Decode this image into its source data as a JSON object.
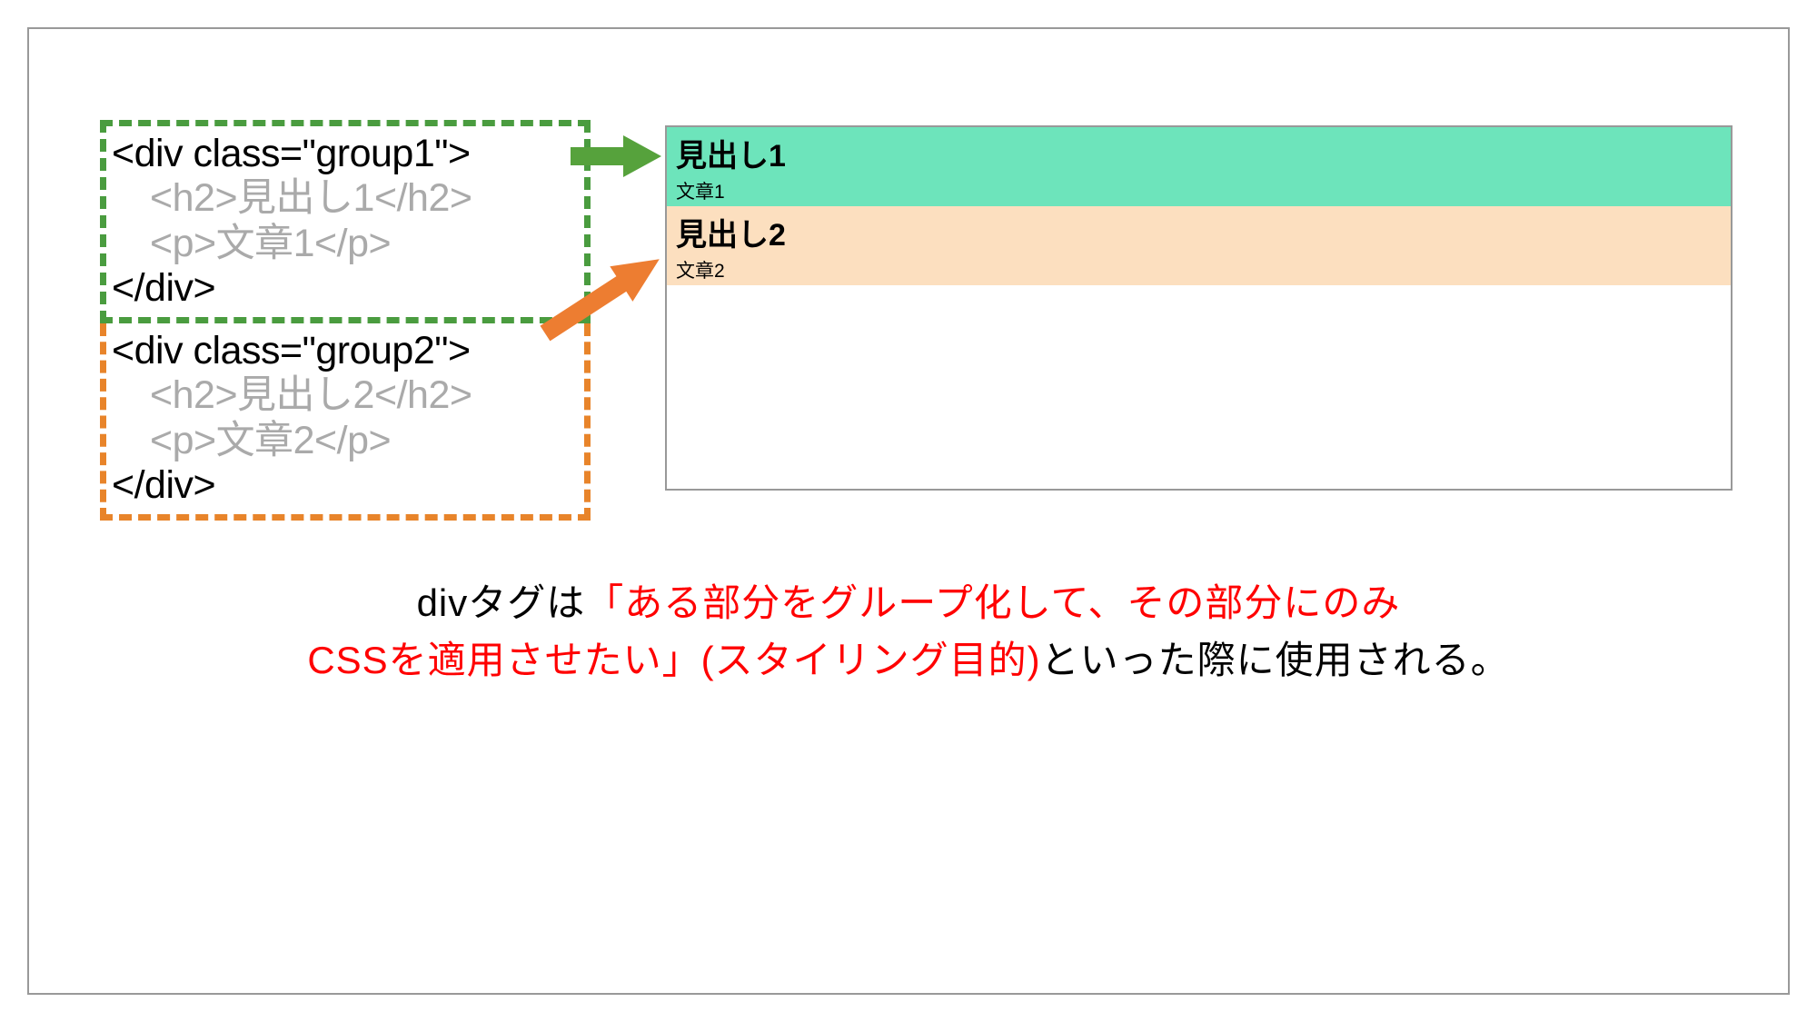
{
  "code": {
    "group1": {
      "open": "<div class=\"group1\">",
      "h2": "<h2>見出し1</h2>",
      "p": "<p>文章1</p>",
      "close": "</div>"
    },
    "group2": {
      "open": "<div class=\"group2\">",
      "h2": "<h2>見出し2</h2>",
      "p": "<p>文章2</p>",
      "close": "</div>"
    }
  },
  "preview": {
    "group1": {
      "heading": "見出し1",
      "paragraph": "文章1"
    },
    "group2": {
      "heading": "見出し2",
      "paragraph": "文章2"
    }
  },
  "caption": {
    "part1": "divタグは",
    "part2": "「ある部分をグループ化して、その部分にのみ",
    "part3": "CSSを適用させたい」(スタイリング目的)",
    "part4": "といった際に使用される。"
  },
  "colors": {
    "green": "#4a9c3f",
    "orange": "#e8842a",
    "mint": "#6de4bb",
    "peach": "#fcdfbf",
    "red": "#ff0000"
  }
}
